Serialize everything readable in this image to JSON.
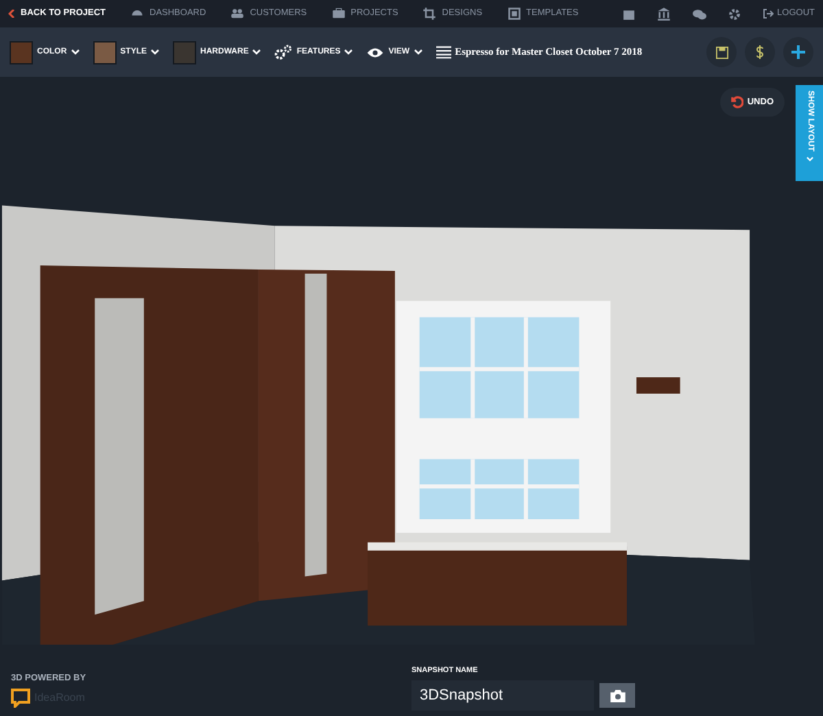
{
  "top_nav": {
    "back": "BACK TO PROJECT",
    "items": [
      {
        "label": "DASHBOARD",
        "kind": "dashboard"
      },
      {
        "label": "CUSTOMERS",
        "kind": "customers"
      },
      {
        "label": "PROJECTS",
        "kind": "projects"
      },
      {
        "label": "DESIGNS",
        "kind": "designs"
      },
      {
        "label": "TEMPLATES",
        "kind": "templates"
      }
    ],
    "logout": "LOGOUT"
  },
  "toolbar": {
    "menus": [
      {
        "label": "COLOR",
        "kind": "swatch",
        "color": "#5a3420"
      },
      {
        "label": "STYLE",
        "kind": "swatch",
        "color": "#7a5a44"
      },
      {
        "label": "HARDWARE",
        "kind": "hardware"
      },
      {
        "label": "FEATURES",
        "kind": "gears"
      },
      {
        "label": "VIEW",
        "kind": "eye"
      }
    ],
    "design_title": "Espresso for Master Closet October 7 2018"
  },
  "canvas": {
    "undo": "UNDO",
    "show_layout": "SHOW LAYOUT"
  },
  "footer": {
    "powered_by": "3D POWERED BY",
    "brand": "IdeaRoom",
    "snapshot_label": "SNAPSHOT NAME",
    "snapshot_value": "3DSnapshot"
  }
}
